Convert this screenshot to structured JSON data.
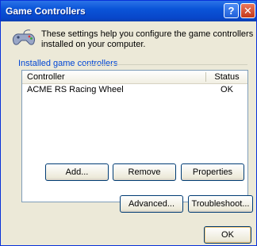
{
  "window": {
    "title": "Game Controllers",
    "help_glyph": "?",
    "close_glyph": "✕"
  },
  "intro": {
    "icon": "game-controller-icon",
    "text": "These settings help you configure the game controllers installed on your computer."
  },
  "group": {
    "label": "Installed game controllers"
  },
  "list": {
    "columns": [
      "Controller",
      "Status"
    ],
    "rows": [
      {
        "controller": "ACME RS Racing Wheel",
        "status": "OK"
      }
    ]
  },
  "buttons": {
    "add": "Add...",
    "remove": "Remove",
    "properties": "Properties",
    "advanced": "Advanced...",
    "troubleshoot": "Troubleshoot...",
    "ok": "OK"
  },
  "colors": {
    "titlebar": "#0a54d8",
    "group_label": "#0046d5",
    "dialog_bg": "#ece9d8"
  }
}
